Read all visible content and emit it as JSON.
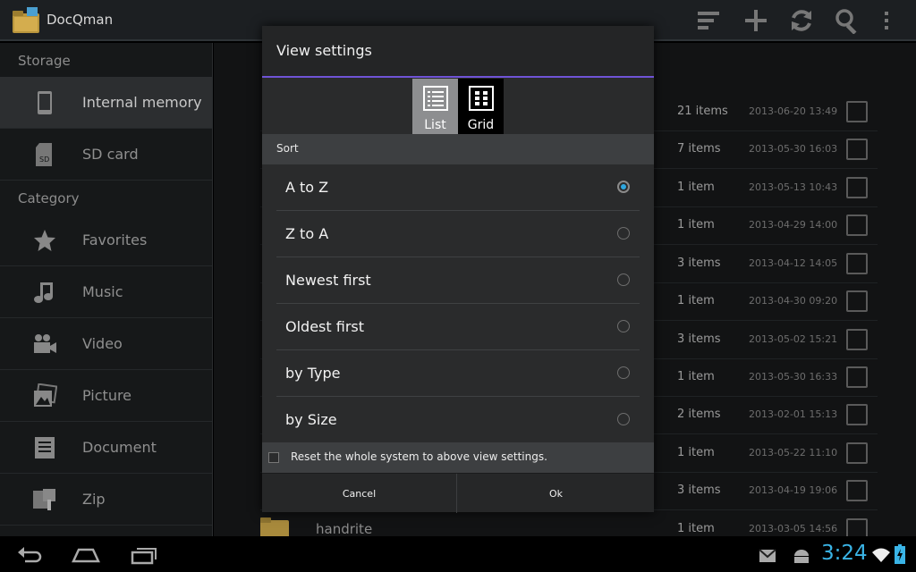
{
  "app": {
    "title": "DocQman"
  },
  "actionbar": {
    "icons": [
      "sort-icon",
      "add-icon",
      "refresh-icon",
      "search-icon",
      "overflow-menu-icon"
    ]
  },
  "drawer": {
    "storage_header": "Storage",
    "category_header": "Category",
    "storage_items": [
      {
        "label": "Internal memory",
        "icon": "phone-icon",
        "active": true
      },
      {
        "label": "SD card",
        "icon": "sd-card-icon",
        "active": false
      }
    ],
    "category_items": [
      {
        "label": "Favorites",
        "icon": "star-icon"
      },
      {
        "label": "Music",
        "icon": "music-note-icon"
      },
      {
        "label": "Video",
        "icon": "video-camera-icon"
      },
      {
        "label": "Picture",
        "icon": "picture-icon"
      },
      {
        "label": "Document",
        "icon": "document-icon"
      },
      {
        "label": "Zip",
        "icon": "zip-icon"
      }
    ]
  },
  "files": [
    {
      "count": "21 items",
      "date": "2013-06-20 13:49"
    },
    {
      "count": "7 items",
      "date": "2013-05-30 16:03"
    },
    {
      "count": "1 item",
      "date": "2013-05-13 10:43"
    },
    {
      "count": "1 item",
      "date": "2013-04-29 14:00"
    },
    {
      "count": "3 items",
      "date": "2013-04-12 14:05"
    },
    {
      "count": "1 item",
      "date": "2013-04-30 09:20"
    },
    {
      "count": "3 items",
      "date": "2013-05-02 15:21"
    },
    {
      "count": "1 item",
      "date": "2013-05-30 16:33"
    },
    {
      "count": "2 items",
      "date": "2013-02-01 15:13"
    },
    {
      "count": "1 item",
      "date": "2013-05-22 11:10"
    },
    {
      "count": "3 items",
      "date": "2013-04-19 19:06"
    },
    {
      "name": "handrite",
      "count": "1 item",
      "date": "2013-03-05 14:56"
    }
  ],
  "dialog": {
    "title": "View settings",
    "view_modes": [
      {
        "label": "List",
        "selected": true
      },
      {
        "label": "Grid",
        "selected": false
      }
    ],
    "sort_header": "Sort",
    "sort_options": [
      {
        "label": "A to Z",
        "selected": true
      },
      {
        "label": "Z to A",
        "selected": false
      },
      {
        "label": "Newest first",
        "selected": false
      },
      {
        "label": "Oldest first",
        "selected": false
      },
      {
        "label": "by Type",
        "selected": false
      },
      {
        "label": "by Size",
        "selected": false
      }
    ],
    "reset_label": "Reset the whole system to above view settings.",
    "cancel_label": "Cancel",
    "ok_label": "Ok"
  },
  "status": {
    "time": "3:24"
  },
  "colors": {
    "accent": "#6f53d6",
    "radio_on": "#2ea7e0",
    "clock": "#3ab4e6"
  }
}
